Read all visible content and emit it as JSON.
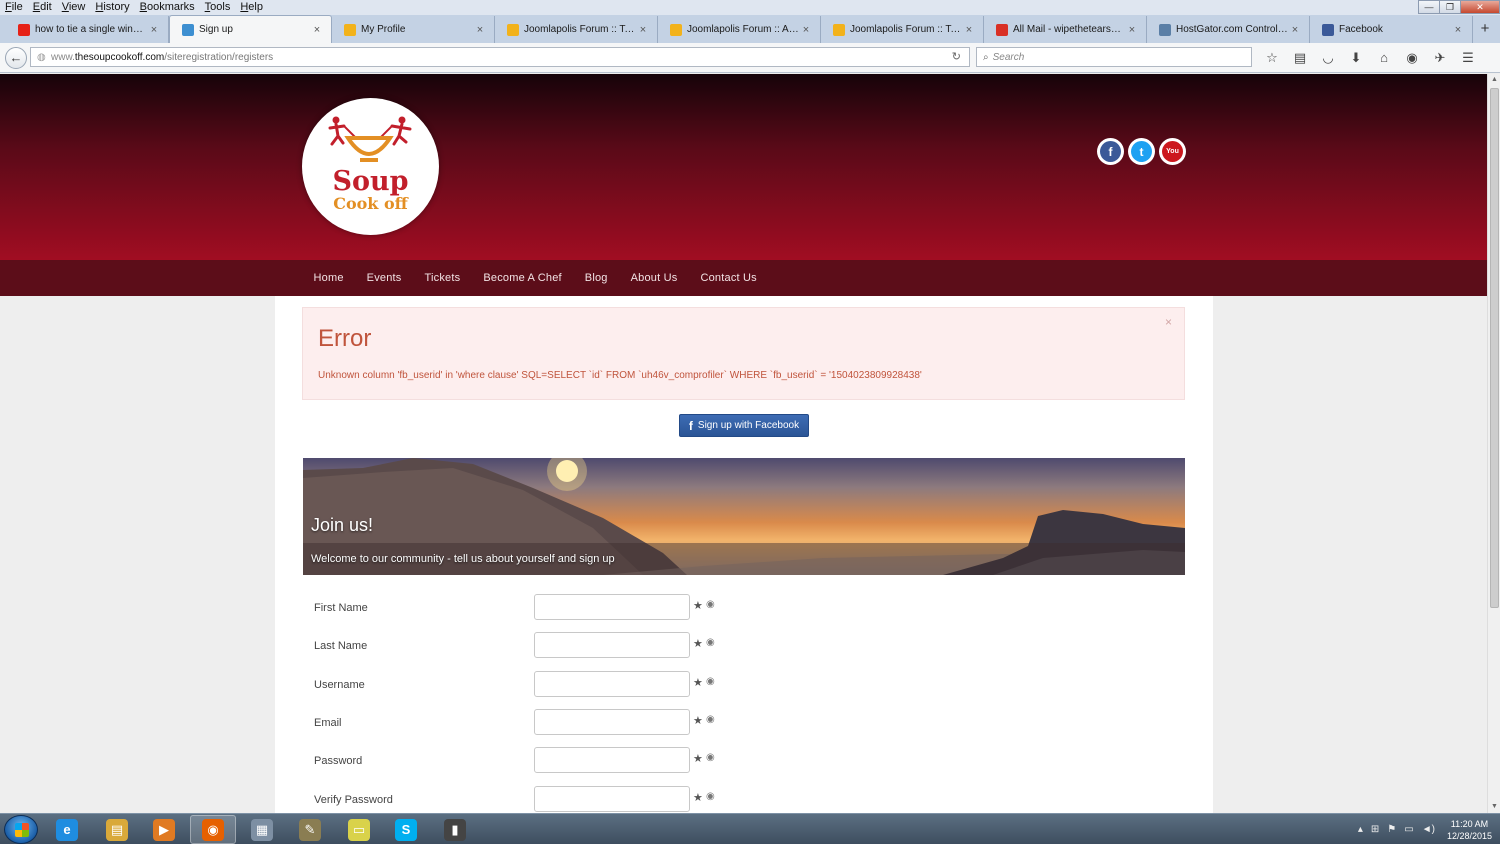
{
  "browser": {
    "menu": [
      "File",
      "Edit",
      "View",
      "History",
      "Bookmarks",
      "Tools",
      "Help"
    ],
    "window_controls": [
      "minimize",
      "maximize",
      "close"
    ],
    "tabs": [
      {
        "label": "how to tie a single windso...",
        "icon": "youtube-icon",
        "color": "#e62117",
        "active": false
      },
      {
        "label": "Sign up",
        "icon": "joomla-icon",
        "color": "#3d8fd1",
        "active": true
      },
      {
        "label": "My Profile",
        "icon": "joomlapolis-icon",
        "color": "#f2b21b",
        "active": false
      },
      {
        "label": "Joomlapolis Forum :: Topi...",
        "icon": "joomlapolis-icon",
        "color": "#f2b21b",
        "active": false
      },
      {
        "label": "Joomlapolis Forum :: Adv...",
        "icon": "joomlapolis-icon",
        "color": "#f2b21b",
        "active": false
      },
      {
        "label": "Joomlapolis Forum :: Topi...",
        "icon": "joomlapolis-icon",
        "color": "#f2b21b",
        "active": false
      },
      {
        "label": "All Mail - wipethetearseve...",
        "icon": "gmail-icon",
        "color": "#d93025",
        "active": false
      },
      {
        "label": "HostGator.com Control P...",
        "icon": "hostgator-icon",
        "color": "#5b7fa6",
        "active": false
      },
      {
        "label": "Facebook",
        "icon": "facebook-icon",
        "color": "#3b5998",
        "active": false
      }
    ],
    "url_host": "www.thesoupcookoff.com",
    "url_path": "/siteregistration/registers",
    "url_prefix": "www.",
    "url_domain": "thesoupcookoff.com",
    "search_placeholder": "Search"
  },
  "site": {
    "logo_line1": "Soup",
    "logo_line2": "Cook off",
    "social": [
      {
        "name": "facebook",
        "glyph": "f",
        "color": "#3b5998"
      },
      {
        "name": "twitter",
        "glyph": "t",
        "color": "#1da1f2"
      },
      {
        "name": "youtube",
        "glyph": "You",
        "color": "#cc181e"
      }
    ],
    "nav": [
      "Home",
      "Events",
      "Tickets",
      "Become A Chef",
      "Blog",
      "About Us",
      "Contact Us"
    ]
  },
  "error": {
    "title": "Error",
    "message": "Unknown column 'fb_userid' in 'where clause' SQL=SELECT `id` FROM `uh46v_comprofiler` WHERE `fb_userid` = '1504023809928438'",
    "close": "×"
  },
  "facebook_button": {
    "label": "Sign up with Facebook"
  },
  "banner": {
    "title": "Join us!",
    "subtitle": "Welcome to our community - tell us about yourself and sign up"
  },
  "form": {
    "fields": [
      {
        "label": "First Name",
        "value": ""
      },
      {
        "label": "Last Name",
        "value": ""
      },
      {
        "label": "Username",
        "value": ""
      },
      {
        "label": "Email",
        "value": ""
      },
      {
        "label": "Password",
        "value": ""
      },
      {
        "label": "Verify Password",
        "value": ""
      }
    ]
  },
  "taskbar": {
    "apps": [
      {
        "name": "internet-explorer",
        "glyph": "e",
        "color": "#1f8de0"
      },
      {
        "name": "file-explorer",
        "glyph": "▤",
        "color": "#d9a93a"
      },
      {
        "name": "media-player",
        "glyph": "▶",
        "color": "#e07a22"
      },
      {
        "name": "firefox",
        "glyph": "◉",
        "color": "#e66000"
      },
      {
        "name": "calculator",
        "glyph": "▦",
        "color": "#7d8fa3"
      },
      {
        "name": "notepad",
        "glyph": "✎",
        "color": "#8a7d52"
      },
      {
        "name": "sticky-notes",
        "glyph": "▭",
        "color": "#d9d24a"
      },
      {
        "name": "skype",
        "glyph": "S",
        "color": "#00aff0"
      },
      {
        "name": "device",
        "glyph": "▮",
        "color": "#444444"
      }
    ],
    "time": "11:20 AM",
    "date": "12/28/2015"
  },
  "colors": {
    "header_top": "#160309",
    "header_bottom": "#a10d22",
    "nav_bg": "#5c0d19",
    "error_bg": "#fdeeee",
    "error_text": "#c0543c",
    "facebook_blue": "#3b5998"
  }
}
